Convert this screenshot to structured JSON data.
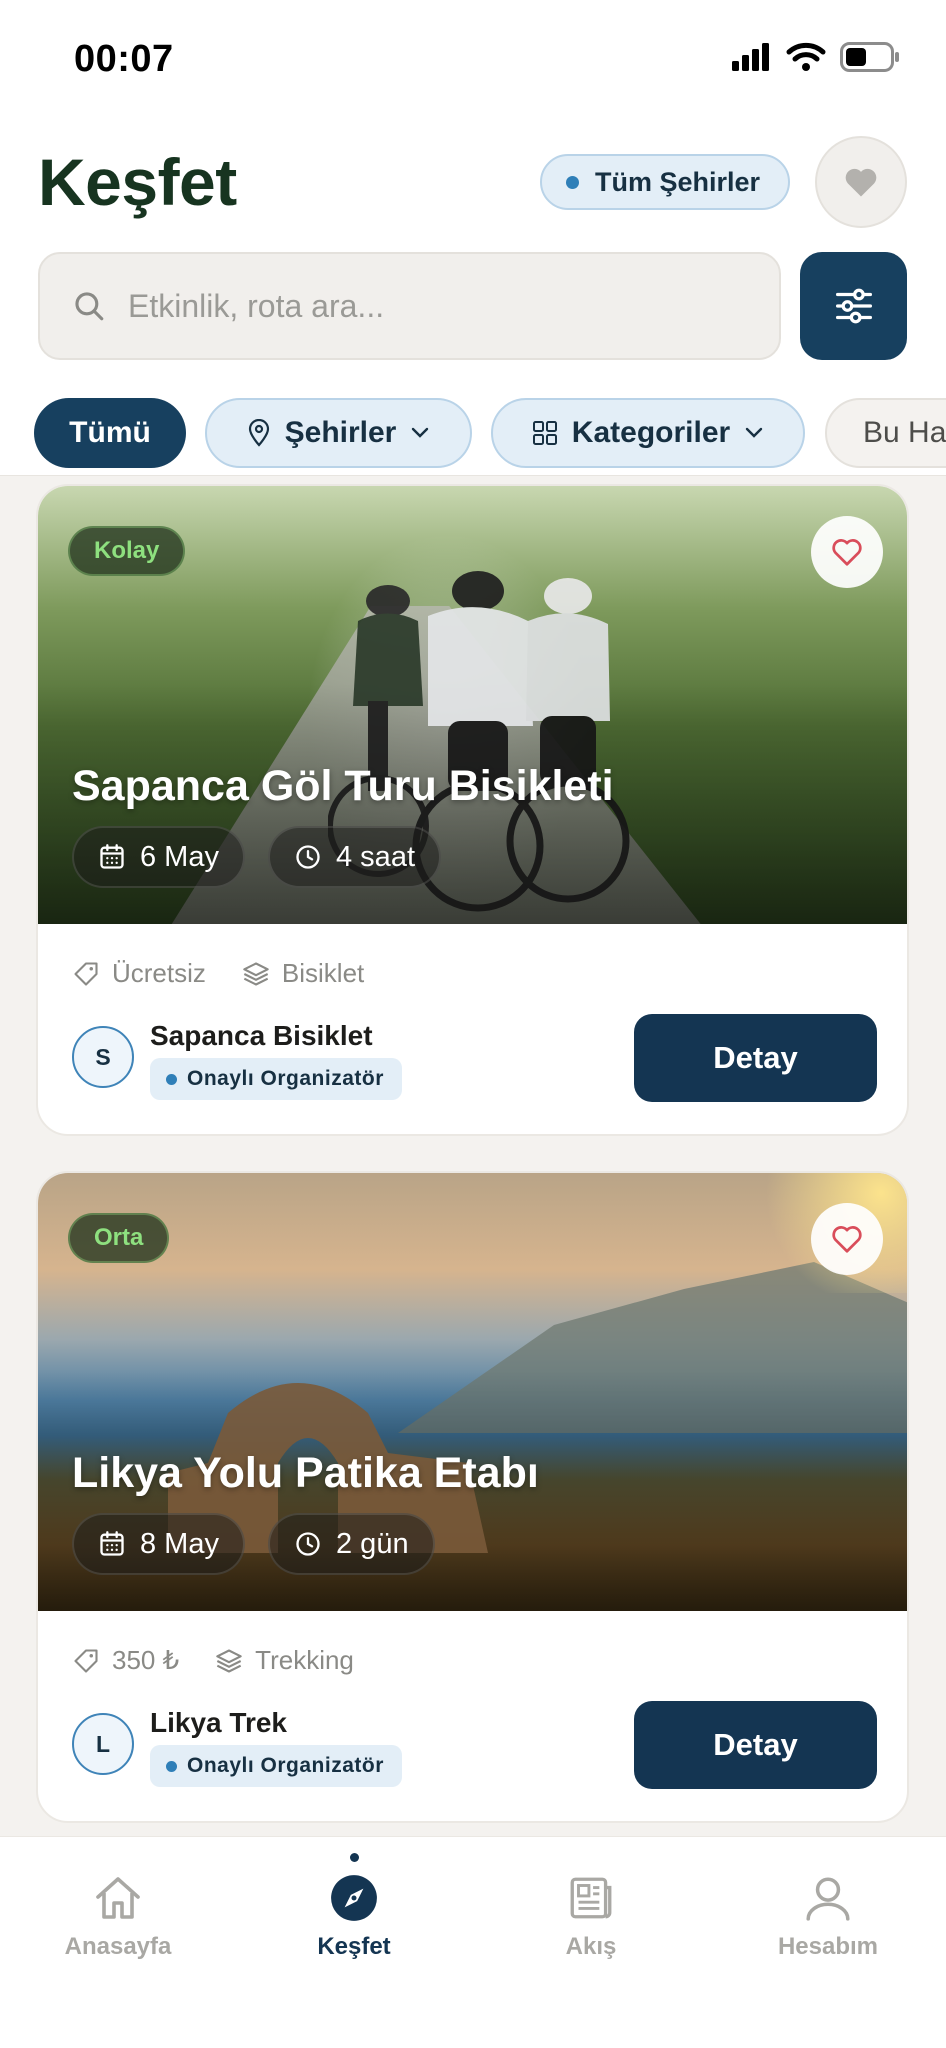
{
  "status_bar": {
    "time": "00:07"
  },
  "header": {
    "title": "Keşfet",
    "city_selector": "Tüm Şehirler",
    "search_placeholder": "Etkinlik, rota ara..."
  },
  "filters": {
    "all": "Tümü",
    "cities": "Şehirler",
    "categories": "Kategoriler",
    "this_week": "Bu Hafta"
  },
  "events": [
    {
      "level": "Kolay",
      "title": "Sapanca Göl Turu Bisikleti",
      "date": "6 May",
      "duration": "4 saat",
      "price": "Ücretsiz",
      "category": "Bisiklet",
      "organizer_initial": "S",
      "organizer_name": "Sapanca Bisiklet",
      "verified_label": "Onaylı Organizatör",
      "detail_label": "Detay"
    },
    {
      "level": "Orta",
      "title": "Likya Yolu Patika Etabı",
      "date": "8 May",
      "duration": "2 gün",
      "price": "350 ₺",
      "category": "Trekking",
      "organizer_initial": "L",
      "organizer_name": "Likya Trek",
      "verified_label": "Onaylı Organizatör",
      "detail_label": "Detay"
    }
  ],
  "bottom_nav": {
    "home": "Anasayfa",
    "explore": "Keşfet",
    "feed": "Akış",
    "account": "Hesabım"
  },
  "colors": {
    "primary": "#143552",
    "title_green": "#173420",
    "chip_blue_bg": "#e3eef7",
    "level_green": "#8ee07f"
  },
  "icons": {
    "signal": "signal-icon",
    "wifi": "wifi-icon",
    "battery": "battery-icon",
    "heart": "heart-icon",
    "search": "search-icon",
    "filter": "sliders-icon",
    "location": "map-pin-icon",
    "grid": "grid-icon",
    "chevron": "chevron-down-icon",
    "calendar": "calendar-icon",
    "clock": "clock-icon",
    "tag": "tag-icon",
    "layers": "layers-icon",
    "home": "home-icon",
    "compass": "compass-icon",
    "newspaper": "newspaper-icon",
    "user": "user-icon"
  }
}
